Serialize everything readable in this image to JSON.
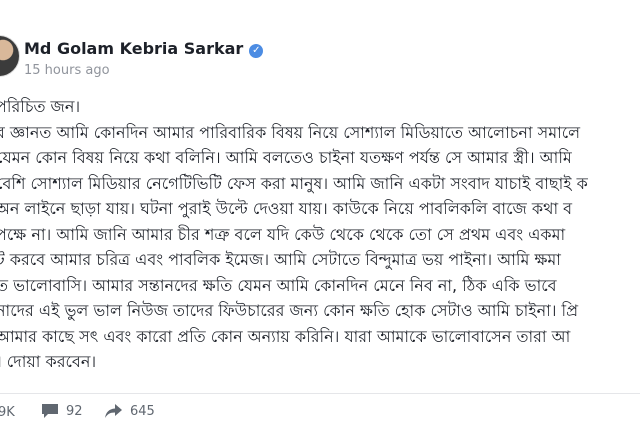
{
  "author": {
    "name": "Md Golam Kebria Sarkar",
    "verified_icon": "verified-badge-icon",
    "time": "15 hours ago"
  },
  "post": {
    "lines": [
      "পরিচিত জন।",
      "র জ্ঞানত আমি কোনদিন আমার পারিবারিক বিষয় নিয়ে সোশ্যাল মিডিয়াতে আলোচনা সমালে",
      "যেমন কোন বিষয় নিয়ে কথা বলিনি। আমি বলতেও চাইনা যতক্ষণ পর্যন্ত সে আমার স্ত্রী। আমি",
      "বেশি সোশ্যাল মিডিয়ার নেগেটিভিটি ফেস করা মানুষ। আমি জানি একটা সংবাদ যাচাই বাছাই ক",
      "অন লাইনে ছাড়া যায়। ঘটনা পুরাই উল্টে দেওয়া যায়। কাউকে নিয়ে পাবলিকলি বাজে কথা ব",
      "পক্ষে না। আমি জানি আমার চীর শত্রু বলে যদি কেউ থেকে থেকে তো সে প্রথম এবং একমা",
      "ট করবে আমার চরিত্র এবং পাবলিক ইমেজ। আমি সেটাতে বিন্দুমাত্র ভয় পাইনা। আমি ক্ষমা",
      "ত ভালোবাসি। আমার সন্তানদের ক্ষতি যেমন আমি কোনদিন মেনে নিব না, ঠিক একি ভাবে",
      "নাদের এই ভুল ভাল নিউজ তাদের ফিউচারের জন্য কোন ক্ষতি হোক সেটাও আমি চাইনা। প্রি",
      "আমার কাছে সৎ এবং কারো প্রতি কোন অন্যায় করিনি। যারা আমাকে ভালোবাসেন তারা আ",
      "। দোয়া করবেন।"
    ]
  },
  "stats": {
    "reactions": "9K",
    "comments": "92",
    "shares": "645"
  }
}
